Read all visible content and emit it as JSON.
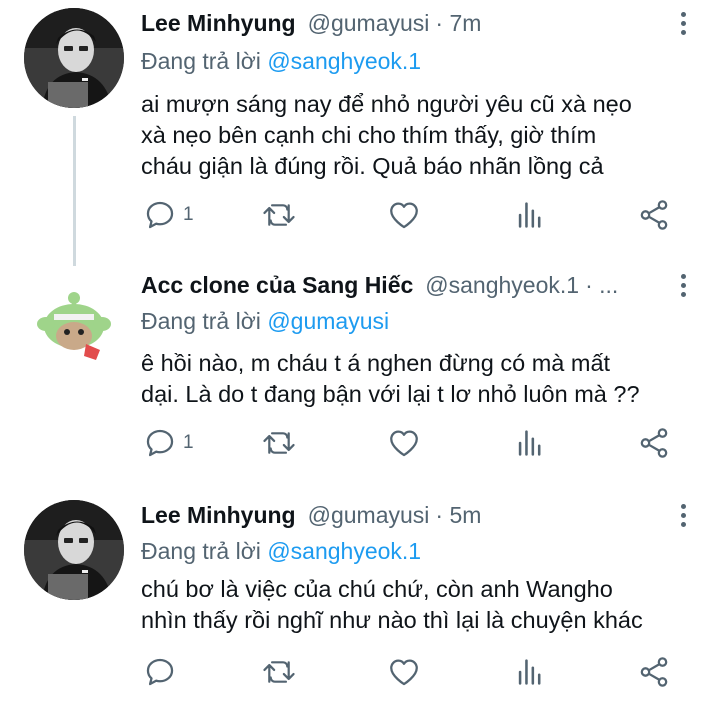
{
  "reply_prefix": "Đang trả lời",
  "tweets": [
    {
      "name": "Lee Minhyung",
      "handle": "@gumayusi",
      "time": "· 7m",
      "reply_to": "@sanghyeok.1",
      "body_lines": [
        "ai mượn sáng nay để nhỏ người yêu cũ xà nẹo",
        "xà nẹo bên cạnh chi cho thím thấy, giờ thím",
        "cháu giận là đúng rồi. Quả báo nhãn lồng cả"
      ],
      "reply_count": "1",
      "avatar": "dark-portrait-avatar"
    },
    {
      "name": "Acc clone của Sang Hiếc",
      "handle": "@sanghyeok.1",
      "time": "· ...",
      "reply_to": "@gumayusi",
      "body_lines": [
        "ê hồi nào, m cháu t á nghen đừng có mà mất",
        "dại. Là do t đang bận với lại t lơ nhỏ luôn mà ??"
      ],
      "reply_count": "1",
      "avatar": "green-alien-avatar"
    },
    {
      "name": "Lee Minhyung",
      "handle": "@gumayusi",
      "time": "· 5m",
      "reply_to": "@sanghyeok.1",
      "body_lines": [
        "chú bơ là việc của chú chứ, còn anh Wangho",
        "nhìn thấy rồi nghĩ như nào thì lại là chuyện khác"
      ],
      "reply_count": "",
      "avatar": "dark-portrait-avatar"
    }
  ],
  "colors": {
    "link": "#1d9bf0",
    "secondary": "#536471",
    "text": "#0f1419",
    "thread": "#cfd9de"
  }
}
